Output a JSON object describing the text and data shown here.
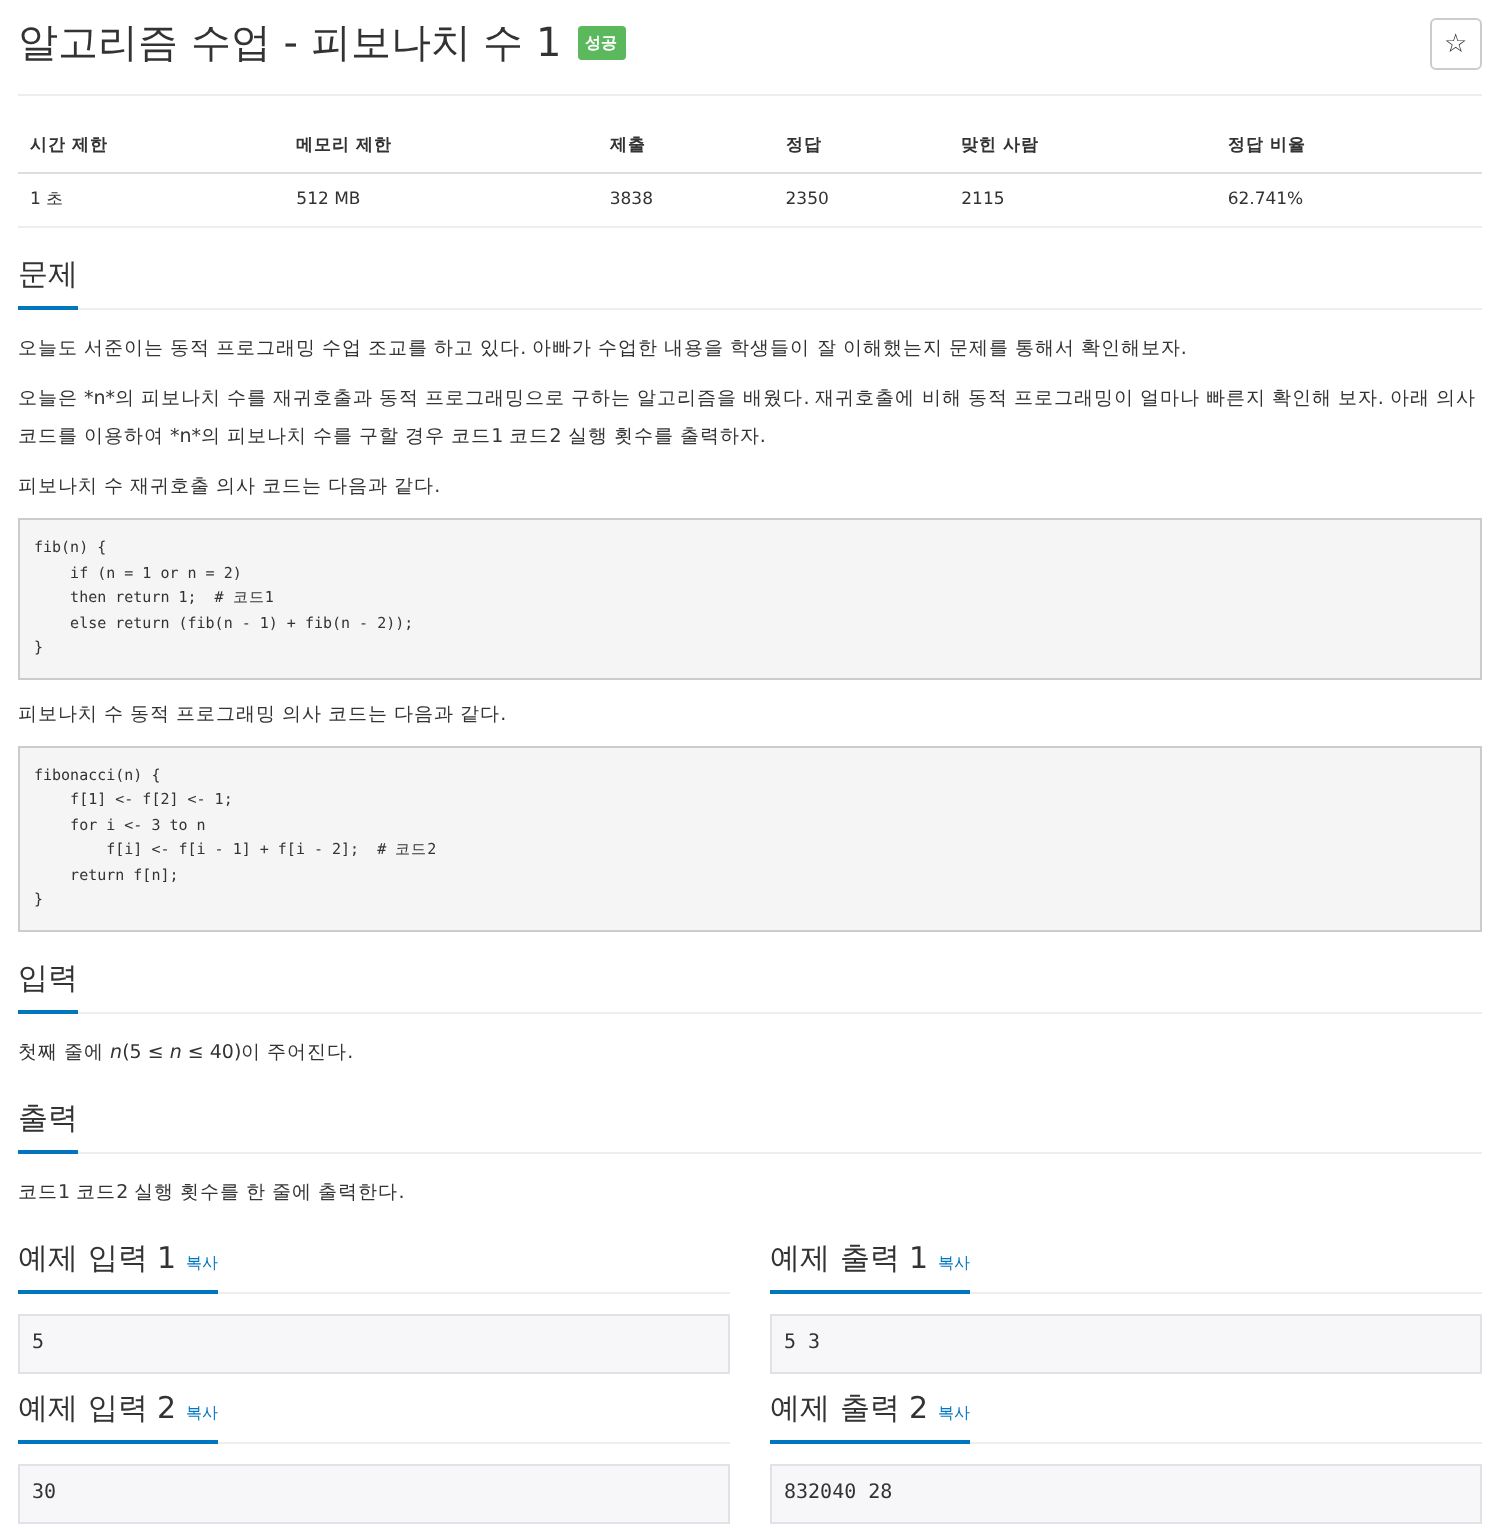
{
  "title": "알고리즘 수업 - 피보나치 수 1",
  "result_badge": "성공",
  "star_button": "☆",
  "stats": {
    "columns": [
      "시간 제한",
      "메모리 제한",
      "제출",
      "정답",
      "맞힌 사람",
      "정답 비율"
    ],
    "values": [
      "1 초",
      "512 MB",
      "3838",
      "2350",
      "2115",
      "62.741%"
    ]
  },
  "sections": [
    {
      "heading": "문제",
      "blocks": [
        {
          "kind": "text",
          "text": "오늘도 서준이는 동적 프로그래밍 수업 조교를 하고 있다. 아빠가 수업한 내용을 학생들이 잘 이해했는지 문제를 통해서 확인해보자."
        },
        {
          "kind": "text",
          "text": "오늘은 *n*의 피보나치 수를 재귀호출과 동적 프로그래밍으로 구하는 알고리즘을 배웠다. 재귀호출에 비해 동적 프로그래밍이 얼마나 빠른지 확인해 보자. 아래 의사 코드를 이용하여 *n*의 피보나치 수를 구할 경우 코드1 코드2 실행 횟수를 출력하자."
        },
        {
          "kind": "text",
          "text": "피보나치 수 재귀호출 의사 코드는 다음과 같다."
        },
        {
          "kind": "code",
          "text": "fib(n) {\n    if (n = 1 or n = 2)\n    then return 1;  # 코드1\n    else return (fib(n - 1) + fib(n - 2));\n}"
        },
        {
          "kind": "text",
          "text": "피보나치 수 동적 프로그래밍 의사 코드는 다음과 같다."
        },
        {
          "kind": "code",
          "text": "fibonacci(n) {\n    f[1] <- f[2] <- 1;\n    for i <- 3 to n\n        f[i] <- f[i - 1] + f[i - 2];  # 코드2\n    return f[n];\n}"
        }
      ]
    },
    {
      "heading": "입력",
      "blocks": [
        {
          "kind": "text",
          "text": "첫째 줄에 *n*(5 ≤ *n* ≤ 40)이 주어진다."
        }
      ]
    },
    {
      "heading": "출력",
      "blocks": [
        {
          "kind": "text",
          "text": "코드1 코드2 실행 횟수를 한 줄에 출력한다."
        }
      ]
    }
  ],
  "samples": [
    {
      "heading": "예제 입력 1",
      "copy": "복사",
      "value": "5"
    },
    {
      "heading": "예제 출력 1",
      "copy": "복사",
      "value": "5 3"
    },
    {
      "heading": "예제 입력 2",
      "copy": "복사",
      "value": "30"
    },
    {
      "heading": "예제 출력 2",
      "copy": "복사",
      "value": "832040 28"
    }
  ]
}
